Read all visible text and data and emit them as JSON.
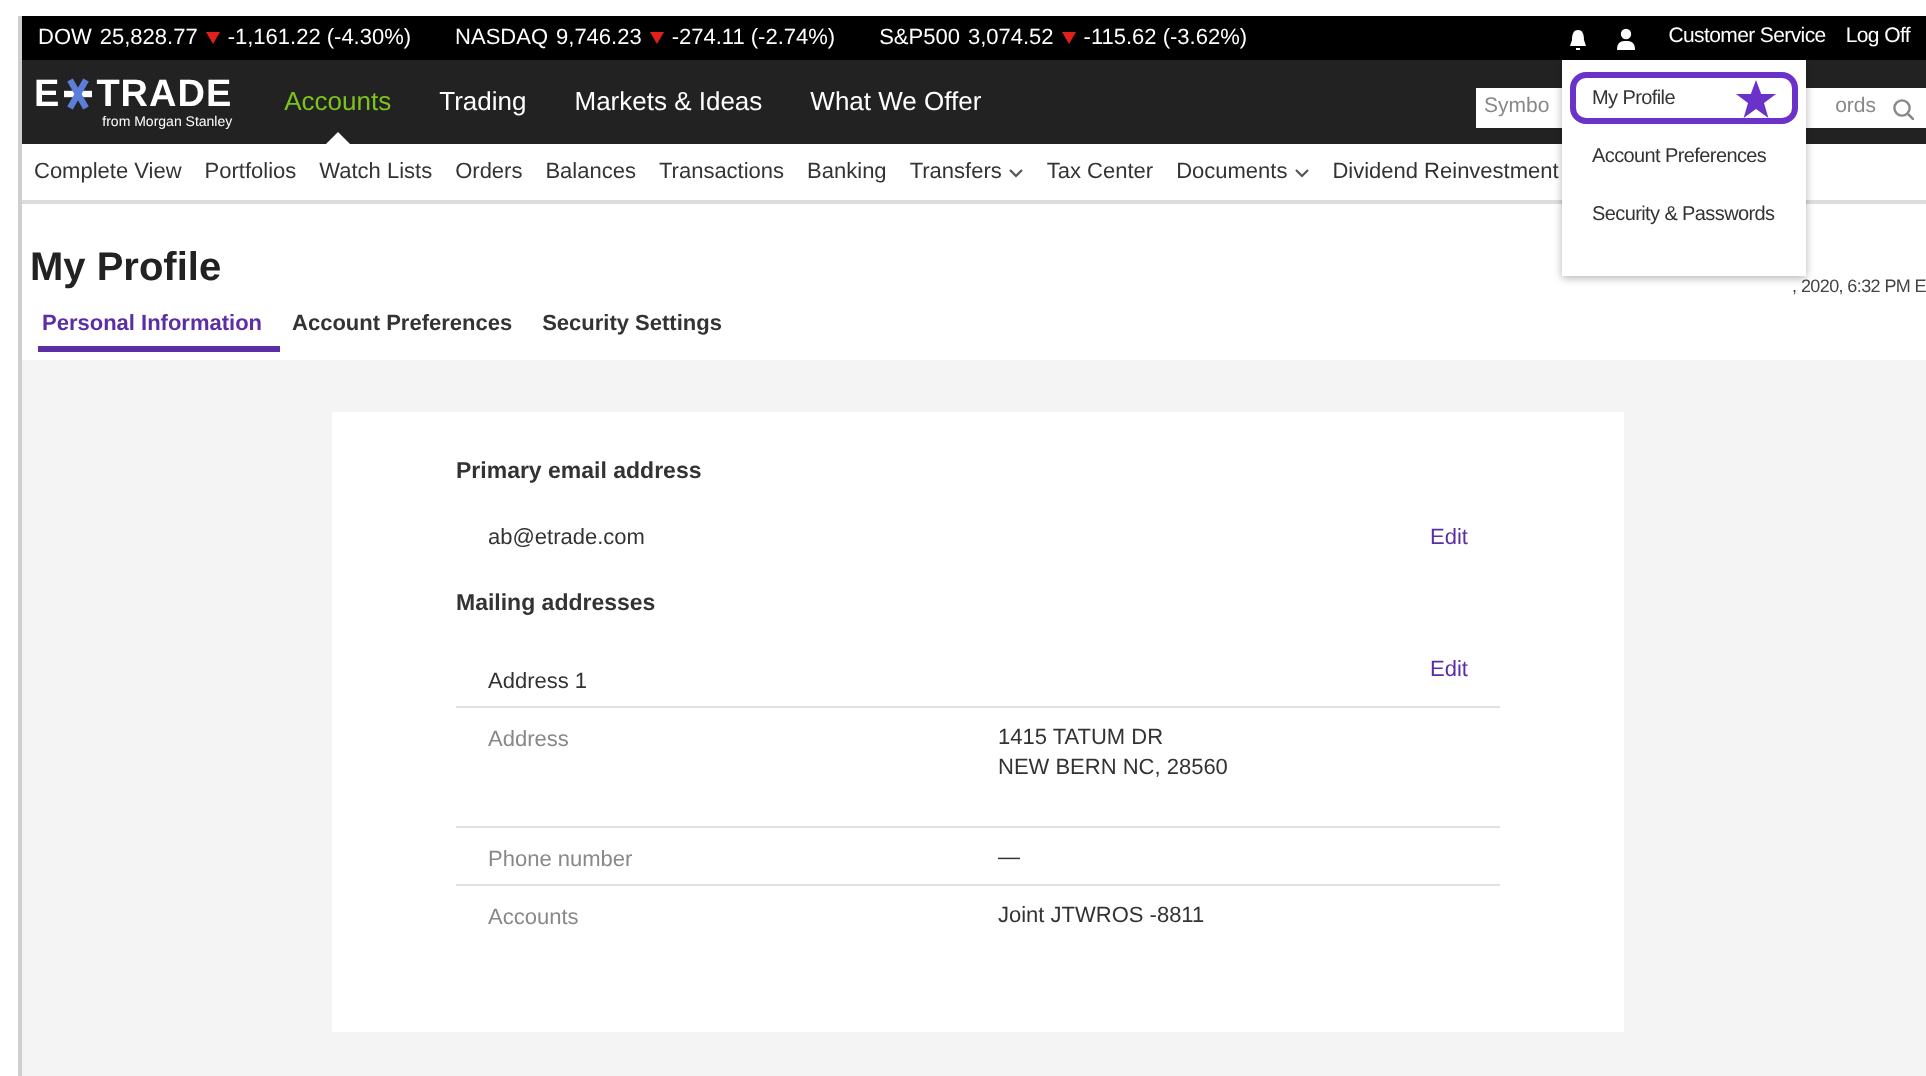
{
  "ticker": [
    {
      "symbol": "DOW",
      "value": "25,828.77",
      "falling": true,
      "change": "-1,161.22 (-4.30%)"
    },
    {
      "symbol": "NASDAQ",
      "value": "9,746.23",
      "falling": true,
      "change": "-274.11 (-2.74%)"
    },
    {
      "symbol": "S&P500",
      "value": "3,074.52",
      "falling": true,
      "change": "-115.62 (-3.62%)"
    }
  ],
  "utility_links": [
    "Customer Service",
    "Log Off"
  ],
  "logo": {
    "left": "E",
    "right": "TRADE",
    "tagline": "from Morgan Stanley"
  },
  "main_nav": [
    {
      "label": "Accounts",
      "selected": true
    },
    {
      "label": "Trading",
      "selected": false
    },
    {
      "label": "Markets & Ideas",
      "selected": false
    },
    {
      "label": "What We Offer",
      "selected": false
    }
  ],
  "search": {
    "visible_start": "Symbo",
    "visible_end": "ords"
  },
  "sub_nav": [
    {
      "label": "Complete View",
      "has_menu": false
    },
    {
      "label": "Portfolios",
      "has_menu": false
    },
    {
      "label": "Watch Lists",
      "has_menu": false
    },
    {
      "label": "Orders",
      "has_menu": false
    },
    {
      "label": "Balances",
      "has_menu": false
    },
    {
      "label": "Transactions",
      "has_menu": false
    },
    {
      "label": "Banking",
      "has_menu": false
    },
    {
      "label": "Transfers",
      "has_menu": true
    },
    {
      "label": "Tax Center",
      "has_menu": false
    },
    {
      "label": "Documents",
      "has_menu": true
    },
    {
      "label": "Dividend Reinvestment",
      "has_menu": false
    }
  ],
  "profile_menu": [
    {
      "label": "My Profile",
      "highlighted": true
    },
    {
      "label": "Account Preferences",
      "highlighted": false
    },
    {
      "label": "Security & Passwords",
      "highlighted": false
    }
  ],
  "page_title": "My Profile",
  "timestamp": ", 2020, 6:32 PM E",
  "tabs": [
    {
      "label": "Personal Information",
      "selected": true
    },
    {
      "label": "Account Preferences",
      "selected": false
    },
    {
      "label": "Security Settings",
      "selected": false
    }
  ],
  "email": {
    "heading": "Primary email address",
    "value": "ab@etrade.com",
    "action": "Edit"
  },
  "mailing": {
    "heading": "Mailing addresses",
    "label": "Address 1",
    "action": "Edit",
    "rows": [
      {
        "label": "Address",
        "value": "1415 TATUM DR\nNEW BERN NC, 28560"
      },
      {
        "label": "Phone number",
        "value": "—"
      },
      {
        "label": "Accounts",
        "value": "Joint JTWROS -8811"
      }
    ]
  }
}
